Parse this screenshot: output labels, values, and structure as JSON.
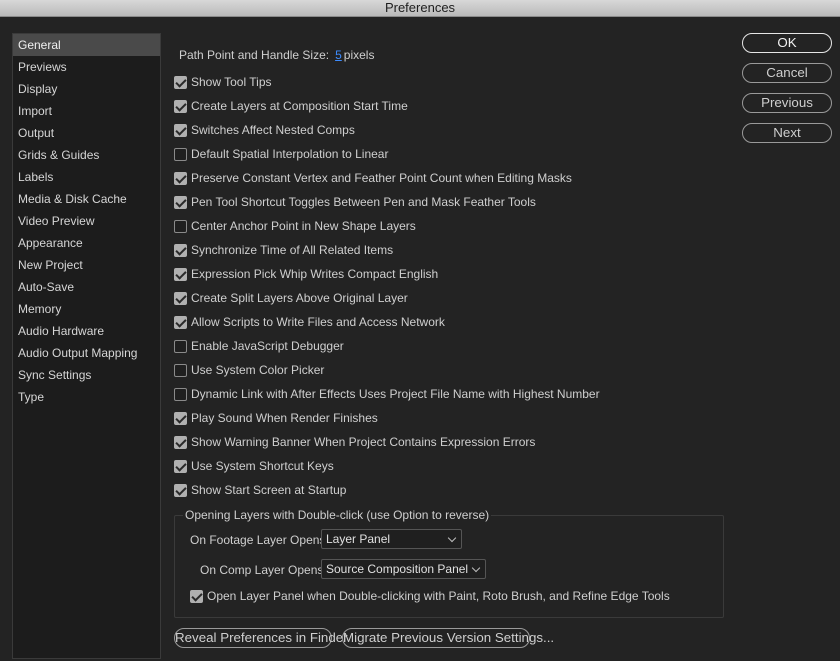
{
  "window": {
    "title": "Preferences"
  },
  "sidebar": {
    "items": [
      {
        "label": "General",
        "active": true
      },
      {
        "label": "Previews"
      },
      {
        "label": "Display"
      },
      {
        "label": "Import"
      },
      {
        "label": "Output"
      },
      {
        "label": "Grids & Guides"
      },
      {
        "label": "Labels"
      },
      {
        "label": "Media & Disk Cache"
      },
      {
        "label": "Video Preview"
      },
      {
        "label": "Appearance"
      },
      {
        "label": "New Project"
      },
      {
        "label": "Auto-Save"
      },
      {
        "label": "Memory"
      },
      {
        "label": "Audio Hardware"
      },
      {
        "label": "Audio Output Mapping"
      },
      {
        "label": "Sync Settings"
      },
      {
        "label": "Type"
      }
    ]
  },
  "general": {
    "path_point": {
      "label": "Path Point and Handle Size:",
      "value": "5",
      "unit": "pixels"
    },
    "options": [
      {
        "label": "Show Tool Tips",
        "checked": true
      },
      {
        "label": "Create Layers at Composition Start Time",
        "checked": true
      },
      {
        "label": "Switches Affect Nested Comps",
        "checked": true
      },
      {
        "label": "Default Spatial Interpolation to Linear",
        "checked": false
      },
      {
        "label": "Preserve Constant Vertex and Feather Point Count when Editing Masks",
        "checked": true
      },
      {
        "label": "Pen Tool Shortcut Toggles Between Pen and Mask Feather Tools",
        "checked": true
      },
      {
        "label": "Center Anchor Point in New Shape Layers",
        "checked": false
      },
      {
        "label": "Synchronize Time of All Related Items",
        "checked": true
      },
      {
        "label": "Expression Pick Whip Writes Compact English",
        "checked": true
      },
      {
        "label": "Create Split Layers Above Original Layer",
        "checked": true
      },
      {
        "label": "Allow Scripts to Write Files and Access Network",
        "checked": true
      },
      {
        "label": "Enable JavaScript Debugger",
        "checked": false
      },
      {
        "label": "Use System Color Picker",
        "checked": false
      },
      {
        "label": "Dynamic Link with After Effects Uses Project File Name with Highest Number",
        "checked": false
      },
      {
        "label": "Play Sound When Render Finishes",
        "checked": true
      },
      {
        "label": "Show Warning Banner When Project Contains Expression Errors",
        "checked": true
      },
      {
        "label": "Use System Shortcut Keys",
        "checked": true
      },
      {
        "label": "Show Start Screen at Startup",
        "checked": true
      }
    ],
    "double_click_group": {
      "title": "Opening Layers with Double-click (use Option to reverse)",
      "footage_label": "On Footage Layer Opens:",
      "footage_value": "Layer Panel",
      "comp_label": "On Comp Layer Opens:",
      "comp_value": "Source Composition Panel",
      "open_layer_panel": {
        "label": "Open Layer Panel when Double-clicking with Paint, Roto Brush, and Refine Edge Tools",
        "checked": true
      }
    },
    "reveal_button": "Reveal Preferences in Finder",
    "migrate_button": "Migrate Previous Version Settings..."
  },
  "buttons": {
    "ok": "OK",
    "cancel": "Cancel",
    "previous": "Previous",
    "next": "Next"
  }
}
